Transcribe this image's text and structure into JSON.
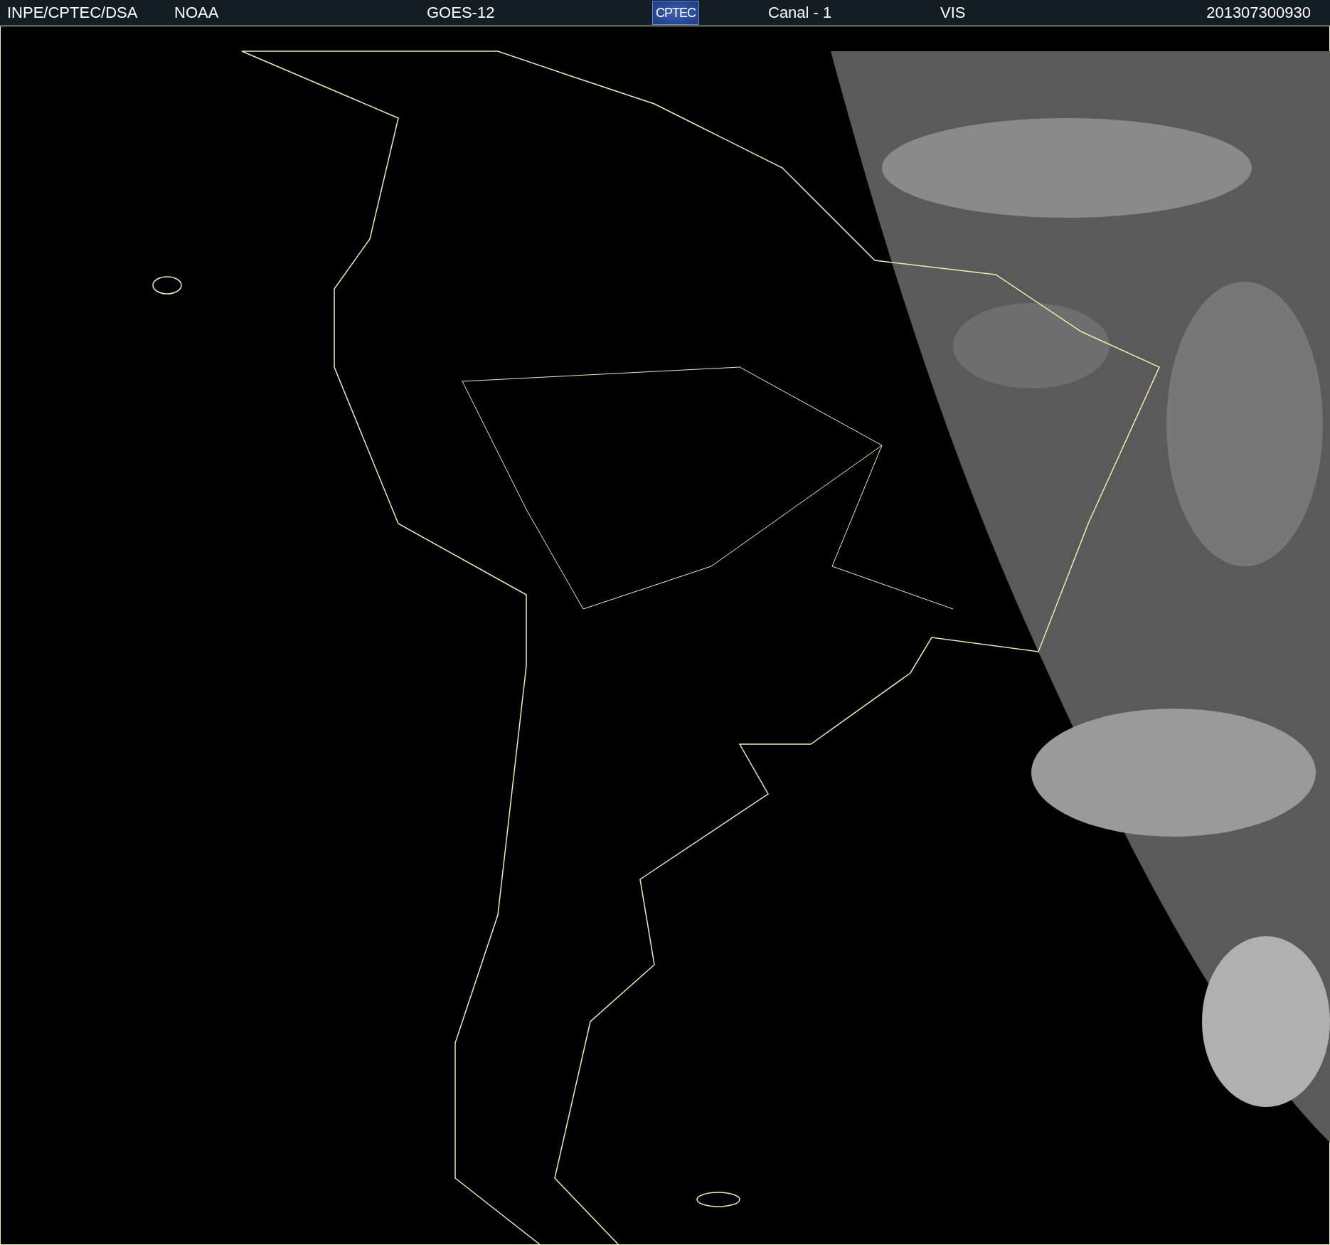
{
  "header": {
    "items": [
      {
        "kind": "text",
        "text": "INPE/CPTEC/DSA"
      },
      {
        "kind": "text",
        "text": "NOAA"
      },
      {
        "kind": "text",
        "text": "GOES-12"
      },
      {
        "kind": "logo",
        "text": "CPTEC"
      },
      {
        "kind": "text",
        "text": "Canal - 1"
      },
      {
        "kind": "text",
        "text": "VIS"
      },
      {
        "kind": "text",
        "text": "201307300930"
      }
    ]
  }
}
